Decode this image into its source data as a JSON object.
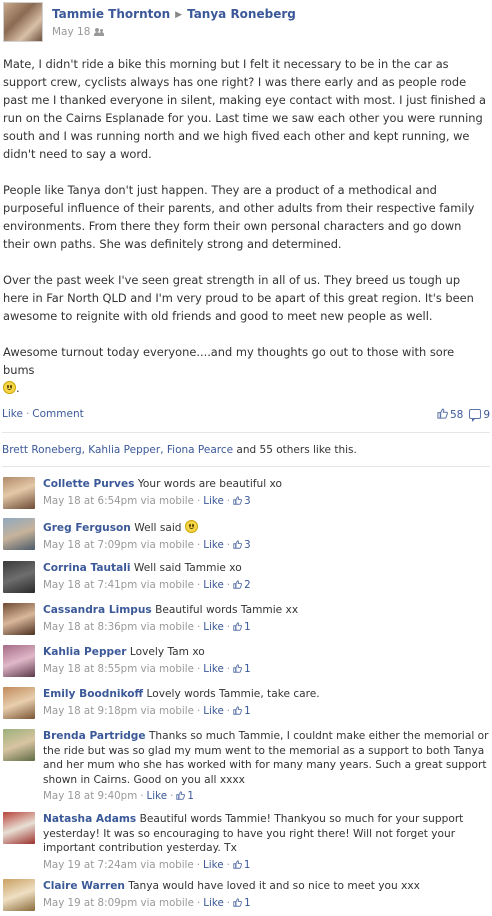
{
  "post": {
    "author": "Tammie Thornton",
    "target": "Tanya Roneberg",
    "date": "May 18",
    "paragraphs": [
      "Mate, I didn't ride a bike this morning but I felt it necessary to be in the car as support crew, cyclists always has one right? I was there early and as people rode past me I thanked everyone in silent, making eye contact with most. I just finished a run on the Cairns Esplanade for you. Last time we saw each other you were running south and I was running north and we high fived each other and kept running, we didn't need to say a word.",
      "People like Tanya don't just happen. They are a product of a methodical and purposeful influence of their parents, and other adults from their respective family environments. From there they form their own personal characters and go down their own paths. She was definitely strong and determined.",
      "Over the past week I've seen great strength in all of us. They breed us tough up here in Far North QLD and I'm very proud to be apart of this great region. It's been awesome to reignite with old friends and good to meet new people as well.",
      "Awesome turnout today everyone....and my thoughts go out to those with sore bums"
    ]
  },
  "actions": {
    "like": "Like",
    "separator": "·",
    "comment": "Comment",
    "like_count": "58",
    "comment_count": "9"
  },
  "likes_summary": {
    "names": "Brett Roneberg, Kahlia Pepper, Fiona Pearce",
    "rest": " and 55 others like this."
  },
  "comment_meta": {
    "like_label": "Like",
    "dot": "·"
  },
  "comments": [
    {
      "name": "Collette Purves",
      "text": "Your words are beautiful xo",
      "time": "May 18 at 6:54pm via mobile",
      "likes": "3"
    },
    {
      "name": "Greg Ferguson",
      "text": "Well said",
      "time": "May 18 at 7:09pm via mobile",
      "likes": "3"
    },
    {
      "name": "Corrina Tautali",
      "text": "Well said Tammie xo",
      "time": "May 18 at 7:41pm via mobile",
      "likes": "2"
    },
    {
      "name": "Cassandra Limpus",
      "text": "Beautiful words Tammie xx",
      "time": "May 18 at 8:36pm via mobile",
      "likes": "1"
    },
    {
      "name": "Kahlia Pepper",
      "text": "Lovely Tam xo",
      "time": "May 18 at 8:55pm via mobile",
      "likes": "1"
    },
    {
      "name": "Emily Boodnikoff",
      "text": "Lovely words Tammie, take care.",
      "time": "May 18 at 9:18pm via mobile",
      "likes": "1"
    },
    {
      "name": "Brenda Partridge",
      "text": "Thanks so much Tammie, I couldnt make either the memorial or the ride but was so glad my mum went to the memorial as a support to both Tanya and her mum who she has worked with for many many years. Such a great support shown in Cairns. Good on you all xxxx",
      "time": "May 18 at 9:40pm",
      "likes": "1"
    },
    {
      "name": "Natasha Adams",
      "text": "Beautiful words Tammie! Thankyou so much for your support yesterday! It was so encouraging to have you right there! Will not forget your important contribution yesterday. Tx",
      "time": "May 19 at 7:24am via mobile",
      "likes": "1"
    },
    {
      "name": "Claire Warren",
      "text": "Tanya would have loved it and so nice to meet you xxx",
      "time": "May 19 at 8:09pm via mobile",
      "likes": "1"
    }
  ],
  "colors": {
    "link": "#3b5998",
    "meta": "#999999",
    "text": "#333333"
  },
  "icons": {
    "arrow": "right-triangle-icon",
    "audience": "friends-icon",
    "like": "thumbs-up-icon",
    "comment": "speech-bubble-icon",
    "emoji": "smiley-icon"
  }
}
